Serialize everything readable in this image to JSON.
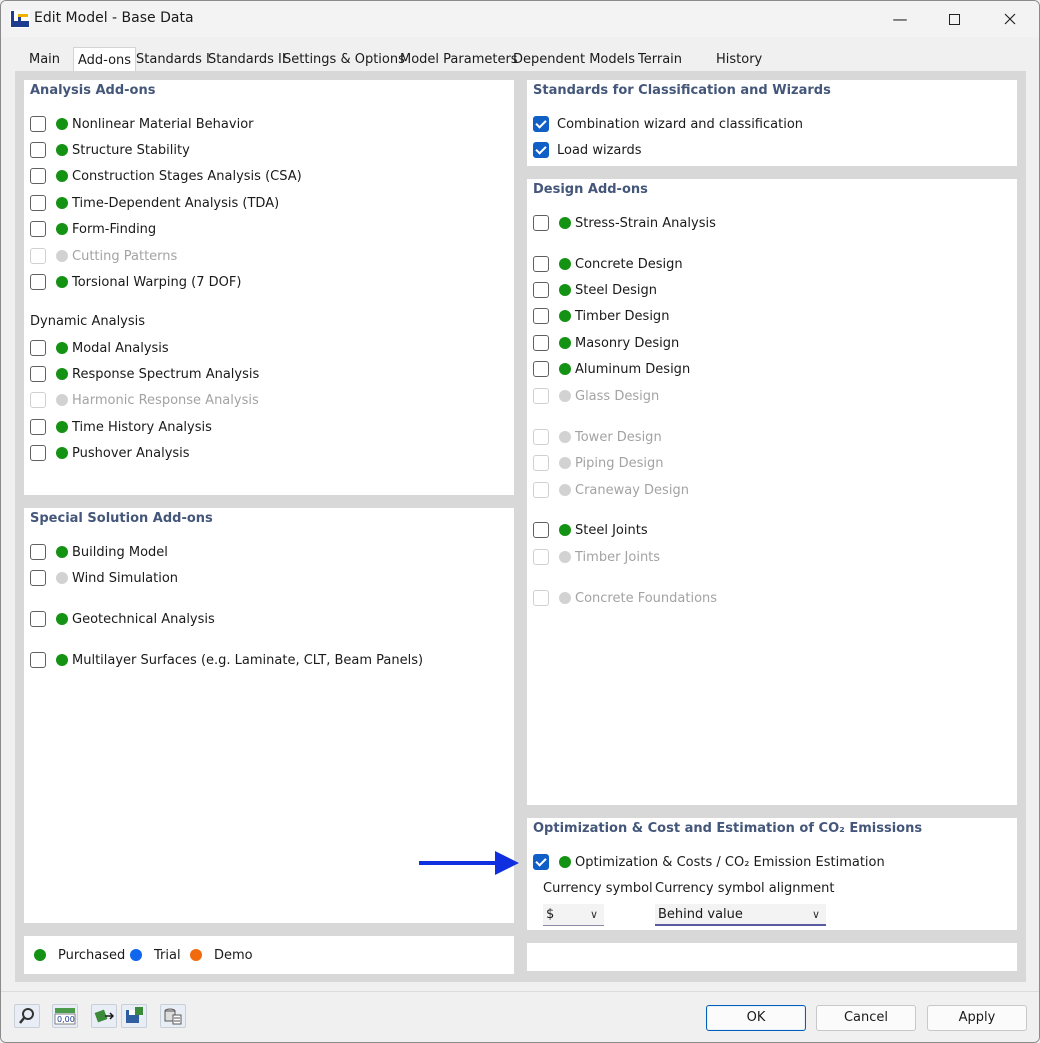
{
  "window": {
    "title": "Edit Model - Base Data"
  },
  "tabs": [
    "Main",
    "Add-ons",
    "Standards I",
    "Standards II",
    "Settings & Options",
    "Model Parameters",
    "Dependent Models",
    "Terrain",
    "History"
  ],
  "analysis": {
    "title": "Analysis Add-ons",
    "items": [
      {
        "label": "Nonlinear Material Behavior"
      },
      {
        "label": "Structure Stability"
      },
      {
        "label": "Construction Stages Analysis (CSA)"
      },
      {
        "label": "Time-Dependent Analysis (TDA)"
      },
      {
        "label": "Form-Finding"
      },
      {
        "label": "Cutting Patterns"
      },
      {
        "label": "Torsional Warping (7 DOF)"
      }
    ],
    "dynamic_title": "Dynamic Analysis",
    "dynamic_items": [
      {
        "label": "Modal Analysis"
      },
      {
        "label": "Response Spectrum Analysis"
      },
      {
        "label": "Harmonic Response Analysis"
      },
      {
        "label": "Time History Analysis"
      },
      {
        "label": "Pushover Analysis"
      }
    ]
  },
  "special": {
    "title": "Special Solution Add-ons",
    "items": [
      {
        "label": "Building Model"
      },
      {
        "label": "Wind Simulation"
      },
      {
        "label": "Geotechnical Analysis"
      },
      {
        "label": "Multilayer Surfaces (e.g. Laminate, CLT, Beam Panels)"
      }
    ]
  },
  "standards": {
    "title": "Standards for Classification and Wizards",
    "items": [
      {
        "label": "Combination wizard and classification"
      },
      {
        "label": "Load wizards"
      }
    ]
  },
  "design": {
    "title": "Design Add-ons",
    "items": [
      {
        "label": "Stress-Strain Analysis"
      },
      {
        "label": "Concrete Design"
      },
      {
        "label": "Steel Design"
      },
      {
        "label": "Timber Design"
      },
      {
        "label": "Masonry Design"
      },
      {
        "label": "Aluminum Design"
      },
      {
        "label": "Glass Design"
      },
      {
        "label": "Tower Design"
      },
      {
        "label": "Piping Design"
      },
      {
        "label": "Craneway Design"
      },
      {
        "label": "Steel Joints"
      },
      {
        "label": "Timber Joints"
      },
      {
        "label": "Concrete Foundations"
      }
    ]
  },
  "optimization": {
    "title": "Optimization & Cost and Estimation of CO₂ Emissions",
    "item_label": "Optimization & Costs / CO₂ Emission Estimation",
    "currency_label": "Currency symbol",
    "currency_value": "$",
    "alignment_label": "Currency symbol alignment",
    "alignment_value": "Behind value"
  },
  "legend": {
    "purchased": "Purchased",
    "trial": "Trial",
    "demo": "Demo"
  },
  "buttons": {
    "ok": "OK",
    "cancel": "Cancel",
    "apply": "Apply"
  },
  "colors": {
    "purchased": "#149214",
    "trial": "#1166ee",
    "demo": "#f26a0e",
    "checked": "#0f5fc7",
    "heading": "#44577a",
    "arrow": "#1030e0"
  }
}
